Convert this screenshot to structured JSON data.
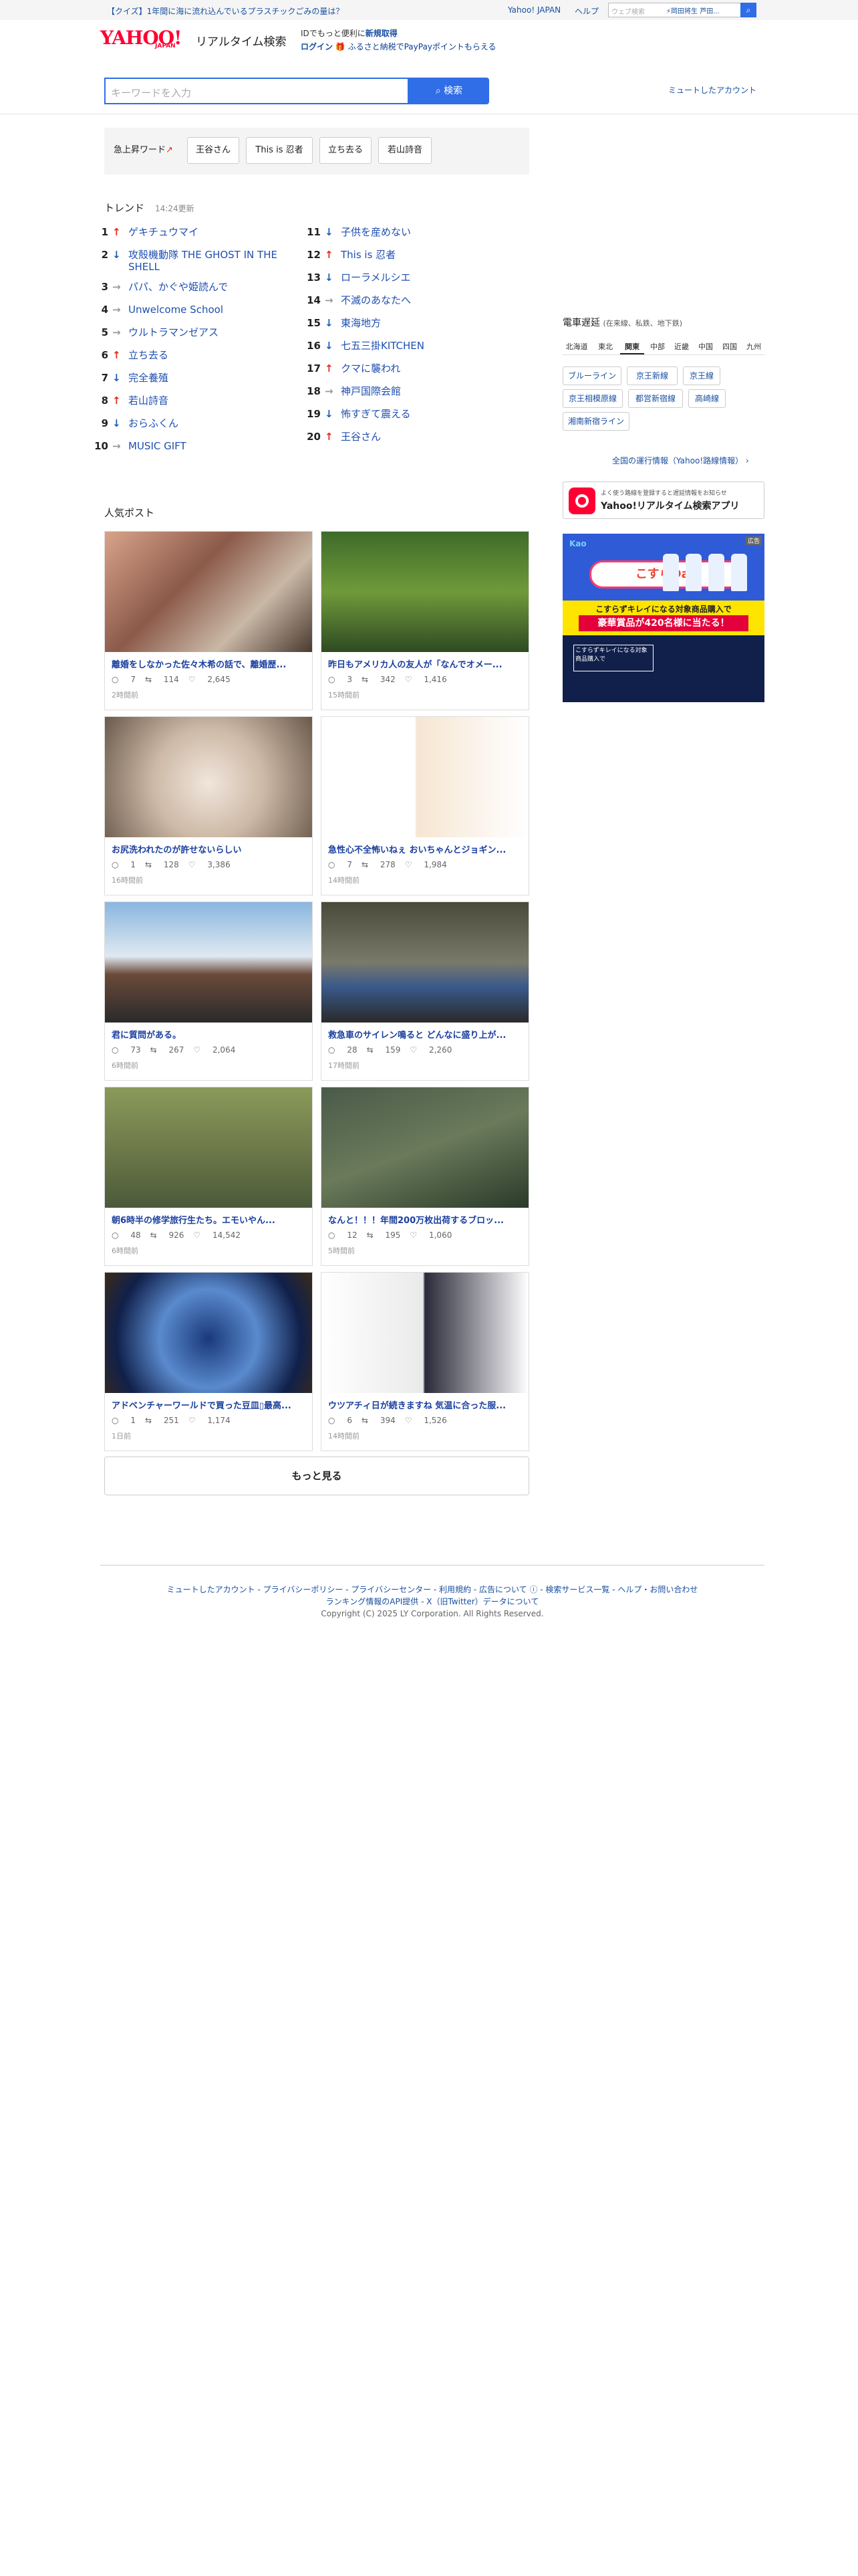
{
  "topbar": {
    "promo": "【クイズ】1年間に海に流れ込んでいるプラスチックごみの量は？",
    "yahoo_japan": "Yahoo! JAPAN",
    "help": "ヘルプ",
    "web_search_placeholder": "ウェブ検索",
    "web_search_tag": "⚡岡田将生 芦田...",
    "search_icon": "search-icon"
  },
  "header": {
    "logo_text": "YAHOO!",
    "logo_sub": "JAPAN",
    "logo_title": "リアルタイム検索",
    "id_line1_prefix": "IDでもっと便利に",
    "id_line1_link": "新規取得",
    "id_line2_link": "ログイン",
    "id_line2_text": "🎁 ふるさと納税でPayPayポイントもらえる"
  },
  "search": {
    "placeholder": "キーワードを入力",
    "button": "検索",
    "muted_accounts": "ミュートしたアカウント"
  },
  "surge": {
    "label": "急上昇ワード",
    "items": [
      "王谷さん",
      "This is 忍者",
      "立ち去る",
      "若山詩音"
    ]
  },
  "trend": {
    "title": "トレンド",
    "updated": "14:24更新",
    "left": [
      {
        "rank": "1",
        "dir": "↑",
        "cls": "up",
        "label": "ゲキチュウマイ"
      },
      {
        "rank": "2",
        "dir": "↓",
        "cls": "down",
        "label": "攻殻機動隊 THE GHOST IN THE SHELL"
      },
      {
        "rank": "3",
        "dir": "→",
        "cls": "flat",
        "label": "パパ、かぐや姫読んで"
      },
      {
        "rank": "4",
        "dir": "→",
        "cls": "flat",
        "label": "Unwelcome School"
      },
      {
        "rank": "5",
        "dir": "→",
        "cls": "flat",
        "label": "ウルトラマンゼアス"
      },
      {
        "rank": "6",
        "dir": "↑",
        "cls": "up",
        "label": "立ち去る"
      },
      {
        "rank": "7",
        "dir": "↓",
        "cls": "down",
        "label": "完全養殖"
      },
      {
        "rank": "8",
        "dir": "↑",
        "cls": "up",
        "label": "若山詩音"
      },
      {
        "rank": "9",
        "dir": "↓",
        "cls": "down",
        "label": "おらふくん"
      },
      {
        "rank": "10",
        "dir": "→",
        "cls": "flat",
        "label": "MUSIC GIFT"
      }
    ],
    "right": [
      {
        "rank": "11",
        "dir": "↓",
        "cls": "down",
        "label": "子供を産めない"
      },
      {
        "rank": "12",
        "dir": "↑",
        "cls": "up",
        "label": "This is 忍者"
      },
      {
        "rank": "13",
        "dir": "↓",
        "cls": "down",
        "label": "ローラメルシエ"
      },
      {
        "rank": "14",
        "dir": "→",
        "cls": "flat",
        "label": "不滅のあなたへ"
      },
      {
        "rank": "15",
        "dir": "↓",
        "cls": "down",
        "label": "東海地方"
      },
      {
        "rank": "16",
        "dir": "↓",
        "cls": "down",
        "label": "七五三掛KITCHEN"
      },
      {
        "rank": "17",
        "dir": "↑",
        "cls": "up",
        "label": "クマに襲われ"
      },
      {
        "rank": "18",
        "dir": "→",
        "cls": "flat",
        "label": "神戸国際会館"
      },
      {
        "rank": "19",
        "dir": "↓",
        "cls": "down",
        "label": "怖すぎて震える"
      },
      {
        "rank": "20",
        "dir": "↑",
        "cls": "up",
        "label": "王谷さん"
      }
    ]
  },
  "popular": {
    "title": "人気ポスト",
    "more": "もっと見る",
    "cards": [
      {
        "title": "離婚をしなかった佐々木希の話で、離婚歴...",
        "replies": "7",
        "reposts": "114",
        "likes": "2,645",
        "time": "2時間前"
      },
      {
        "title": "昨日もアメリカ人の友人が「なんでオメー...",
        "replies": "3",
        "reposts": "342",
        "likes": "1,416",
        "time": "15時間前"
      },
      {
        "title": "お尻洗われたのが許せないらしい",
        "replies": "1",
        "reposts": "128",
        "likes": "3,386",
        "time": "16時間前"
      },
      {
        "title": "急性心不全怖いねぇ おいちゃんとジョギン...",
        "replies": "7",
        "reposts": "278",
        "likes": "1,984",
        "time": "14時間前"
      },
      {
        "title": "君に質問がある。",
        "replies": "73",
        "reposts": "267",
        "likes": "2,064",
        "time": "6時間前"
      },
      {
        "title": "救急車のサイレン鳴ると どんなに盛り上が...",
        "replies": "28",
        "reposts": "159",
        "likes": "2,260",
        "time": "17時間前"
      },
      {
        "title": "朝6時半の修学旅行生たち。エモいやん...",
        "replies": "48",
        "reposts": "926",
        "likes": "14,542",
        "time": "6時間前"
      },
      {
        "title": "なんと！！！年間200万枚出荷するブロッ...",
        "replies": "12",
        "reposts": "195",
        "likes": "1,060",
        "time": "5時間前"
      },
      {
        "title": "アドベンチャーワールドで買った豆皿▯最高...",
        "replies": "1",
        "reposts": "251",
        "likes": "1,174",
        "time": "1日前"
      },
      {
        "title": "ウツアチィ日が続きますね 気温に合った服...",
        "replies": "6",
        "reposts": "394",
        "likes": "1,526",
        "time": "14時間前"
      }
    ]
  },
  "train": {
    "title": "電車遅延",
    "subtitle": "(在来線、私鉄、地下鉄)",
    "regions": [
      "北海道",
      "東北",
      "関東",
      "中部",
      "近畿",
      "中国",
      "四国",
      "九州"
    ],
    "active_region": "関東",
    "lines": [
      "ブルーライン",
      "京王新線",
      "京王線",
      "京王相模原線",
      "都営新宿線",
      "高崎線",
      "湘南新宿ライン"
    ],
    "all_link": "全国の運行情報（Yahoo!路線情報） ›"
  },
  "app_promo": {
    "sub": "よく使う路線を登録すると遅延情報をお知らせ",
    "main": "Yahoo!リアルタイム検索アプリ"
  },
  "ad": {
    "brand": "Kao",
    "tag": "広告",
    "headline": "こすらDay",
    "sub": "こすらずキレイになる対象商品購入で",
    "prize": "豪華賞品が420名様に当たる！",
    "sign": "こすらずキレイになる対象商品購入で"
  },
  "footer": {
    "links": "ミュートしたアカウント - プライバシーポリシー - プライバシーセンター - 利用規約 - 広告について ⓘ - 検索サービス一覧 - ヘルプ・お問い合わせ",
    "links2": "ランキング情報のAPI提供 - X（旧Twitter）データについて",
    "copyright": "Copyright (C) 2025 LY Corporation. All Rights Reserved."
  }
}
